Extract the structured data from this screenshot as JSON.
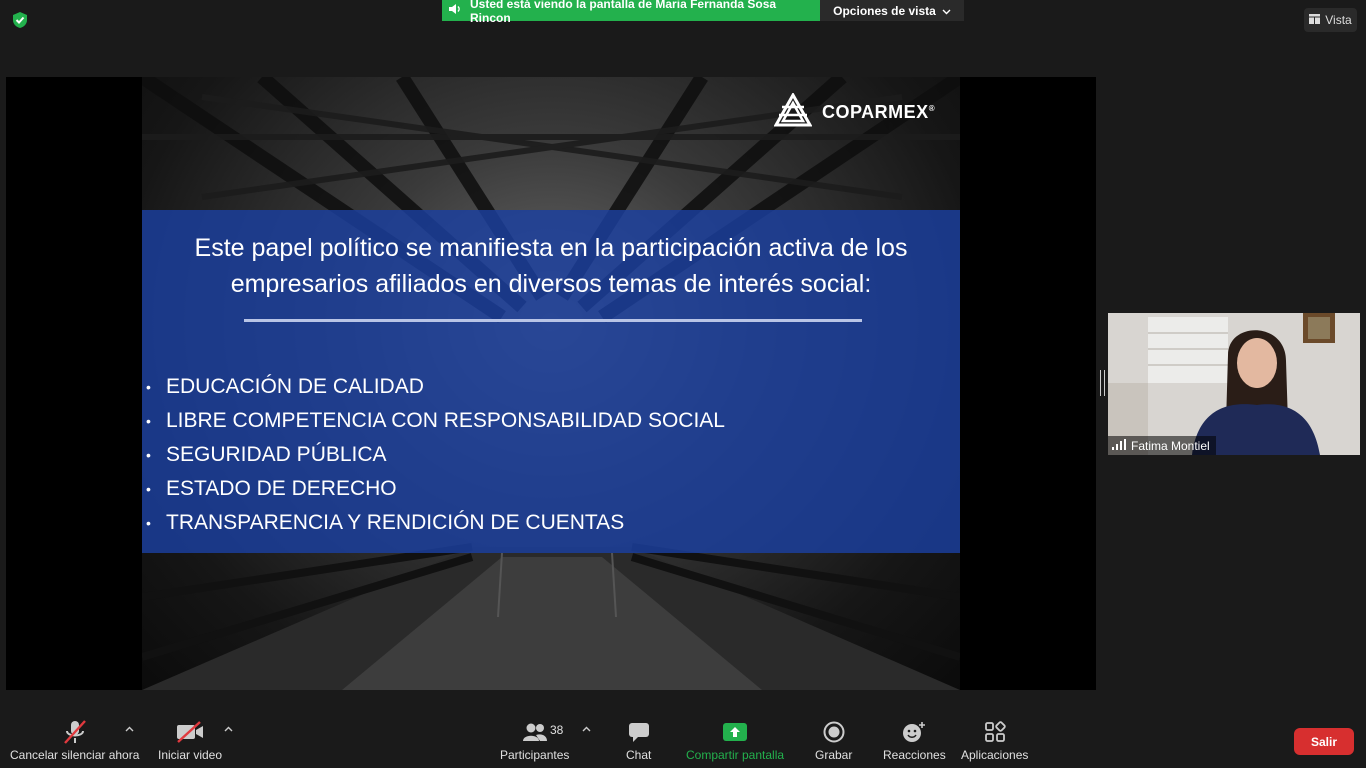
{
  "top_bar": {
    "sharing_notice": "Usted está viendo la pantalla de Maria Fernanda Sosa Rincon",
    "view_options_label": "Opciones de vista",
    "vista_label": "Vista"
  },
  "slide": {
    "logo_text": "COPARMEX",
    "logo_mark": "®",
    "title_lines": [
      "Este papel político se manifiesta en la participación activa de los",
      "empresarios afiliados en diversos temas de interés social:"
    ],
    "bullet_symbol": "•",
    "bullets": [
      "EDUCACIÓN DE CALIDAD",
      "LIBRE COMPETENCIA CON RESPONSABILIDAD SOCIAL",
      "SEGURIDAD PÚBLICA",
      "ESTADO DE DERECHO",
      "TRANSPARENCIA Y RENDICIÓN DE CUENTAS"
    ]
  },
  "participant": {
    "name": "Fatima Montiel"
  },
  "toolbar": {
    "mute_label": "Cancelar silenciar ahora",
    "video_label": "Iniciar video",
    "participants_label": "Participantes",
    "participants_count": "38",
    "chat_label": "Chat",
    "share_label": "Compartir pantalla",
    "record_label": "Grabar",
    "reactions_label": "Reacciones",
    "apps_label": "Aplicaciones",
    "leave_label": "Salir"
  },
  "colors": {
    "share_green": "#23b14d",
    "slide_blue": "#1b40a0",
    "leave_red": "#d72f2f"
  }
}
